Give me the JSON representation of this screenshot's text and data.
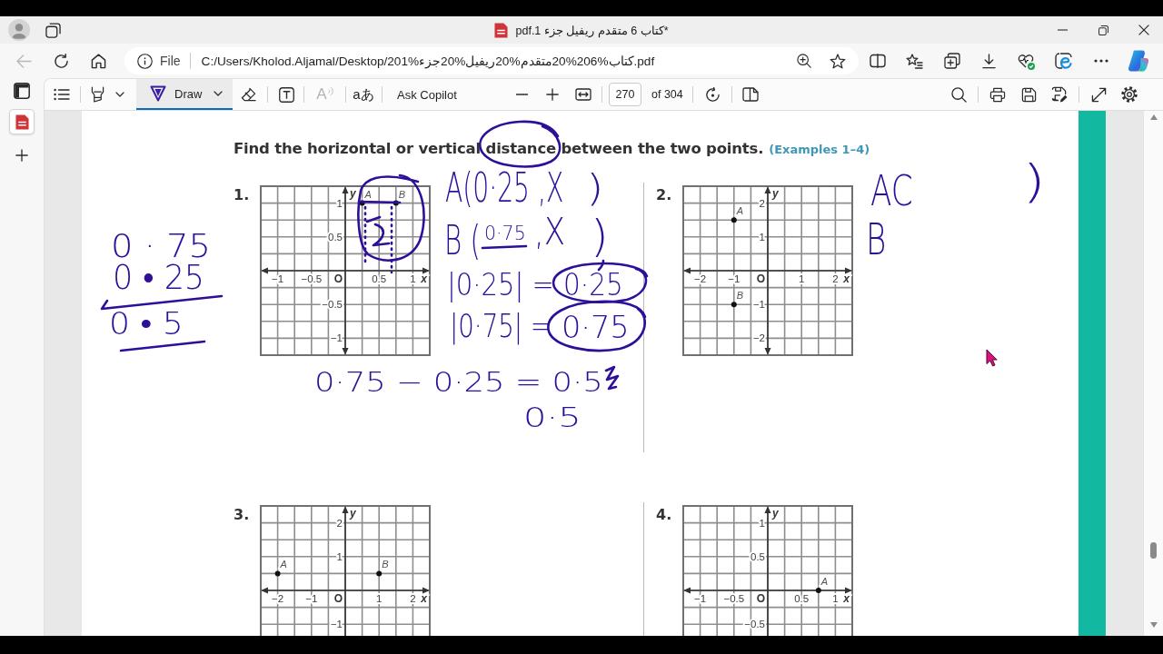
{
  "window": {
    "title": "*كتاب 6 متقدم ريفيل جزء 1.pdf"
  },
  "address_bar": {
    "back_button": {
      "disabled": true
    },
    "site_label": "File",
    "url": "C:/Users/Kholod.Aljamal/Desktop/كتاب%206%20متقدم%20ريفيل%20جزء%201.pdf"
  },
  "tabs": [
    {
      "selected": true
    }
  ],
  "pdf_toolbar": {
    "draw": {
      "label": "Draw",
      "selected": true
    },
    "read_aloud": {
      "label": "A",
      "disabled": true
    },
    "translate": {
      "label": "aあ"
    },
    "ask_copilot": {
      "label": "Ask Copilot"
    },
    "page_number": "270",
    "page_count": "of 304"
  },
  "document": {
    "heading": "Find the horizontal or vertical distance between the two points.",
    "examples_reference": "(Examples 1–4)",
    "problems": [
      {
        "number": "1.",
        "chart_data": {
          "type": "scatter",
          "xlabel": "x",
          "ylabel": "y",
          "grid": true,
          "xlim": [
            -1.25,
            1.25
          ],
          "ylim": [
            -1.25,
            1.25
          ],
          "xticks": [
            {
              "value": -1,
              "label": "−1"
            },
            {
              "value": -0.5,
              "label": "−0.5"
            },
            0.5,
            1
          ],
          "yticks": [
            1,
            0.5,
            {
              "value": -0.5,
              "label": "−0.5"
            },
            {
              "value": -1,
              "label": "−1"
            }
          ],
          "x": [
            0.25,
            0.75
          ],
          "values": [
            1,
            1
          ],
          "annotations": [
            "O",
            {
              "x": 0.25,
              "y": 1,
              "text": "A"
            },
            {
              "x": 0.75,
              "y": 1,
              "text": "B"
            }
          ]
        }
      },
      {
        "number": "2.",
        "chart_data": {
          "type": "scatter",
          "xlabel": "x",
          "ylabel": "y",
          "grid": true,
          "xlim": [
            -2.5,
            2.5
          ],
          "ylim": [
            -2.5,
            2.5
          ],
          "xticks": [
            {
              "value": -2,
              "label": "−2"
            },
            {
              "value": -1,
              "label": "−1"
            },
            1,
            2
          ],
          "yticks": [
            2,
            1,
            {
              "value": -1,
              "label": "−1"
            },
            {
              "value": -2,
              "label": "−2"
            }
          ],
          "x": [
            -1,
            -1
          ],
          "values": [
            1.5,
            -1
          ],
          "annotations": [
            "O",
            {
              "x": -1,
              "y": 1.5,
              "text": "A"
            },
            {
              "x": -1,
              "y": -1,
              "text": "B"
            }
          ]
        }
      },
      {
        "number": "3.",
        "chart_data": {
          "type": "scatter",
          "xlabel": "x",
          "ylabel": "y",
          "grid": true,
          "xlim": [
            -2.5,
            2.5
          ],
          "ylim": [
            -2.5,
            2.5
          ],
          "xticks": [
            {
              "value": -2,
              "label": "−2"
            },
            {
              "value": -1,
              "label": "−1"
            },
            1,
            2
          ],
          "yticks": [
            2,
            1,
            {
              "value": -1,
              "label": "−1"
            }
          ],
          "x": [
            -2,
            1
          ],
          "values": [
            0.5,
            0.5
          ],
          "annotations": [
            "O",
            {
              "x": -2,
              "y": 0.5,
              "text": "A"
            },
            {
              "x": 1,
              "y": 0.5,
              "text": "B"
            }
          ]
        }
      },
      {
        "number": "4.",
        "chart_data": {
          "type": "scatter",
          "xlabel": "x",
          "ylabel": "y",
          "grid": true,
          "xlim": [
            -1.25,
            1.25
          ],
          "ylim": [
            -1.25,
            1.25
          ],
          "xticks": [
            {
              "value": -1,
              "label": "−1"
            },
            {
              "value": -0.5,
              "label": "−0.5"
            },
            0.5,
            1
          ],
          "yticks": [
            1,
            0.5,
            {
              "value": -0.5,
              "label": "−0.5"
            }
          ],
          "x": [
            0.75
          ],
          "values": [
            0
          ],
          "annotations": [
            "O",
            {
              "x": 0.75,
              "y": 0,
              "text": "A"
            }
          ]
        }
      }
    ],
    "ink_notes": [
      "0 · 75",
      "0 • 25",
      "0 • 5",
      "A(0·25 ,X",
      ")",
      "B (",
      "0·75",
      ",X",
      ")",
      "|0·25| =",
      "0·25",
      "|0·75| =",
      "0·75",
      "0·75 − 0·25 = 0·5",
      "0·5",
      "AC",
      ")",
      "B"
    ]
  }
}
